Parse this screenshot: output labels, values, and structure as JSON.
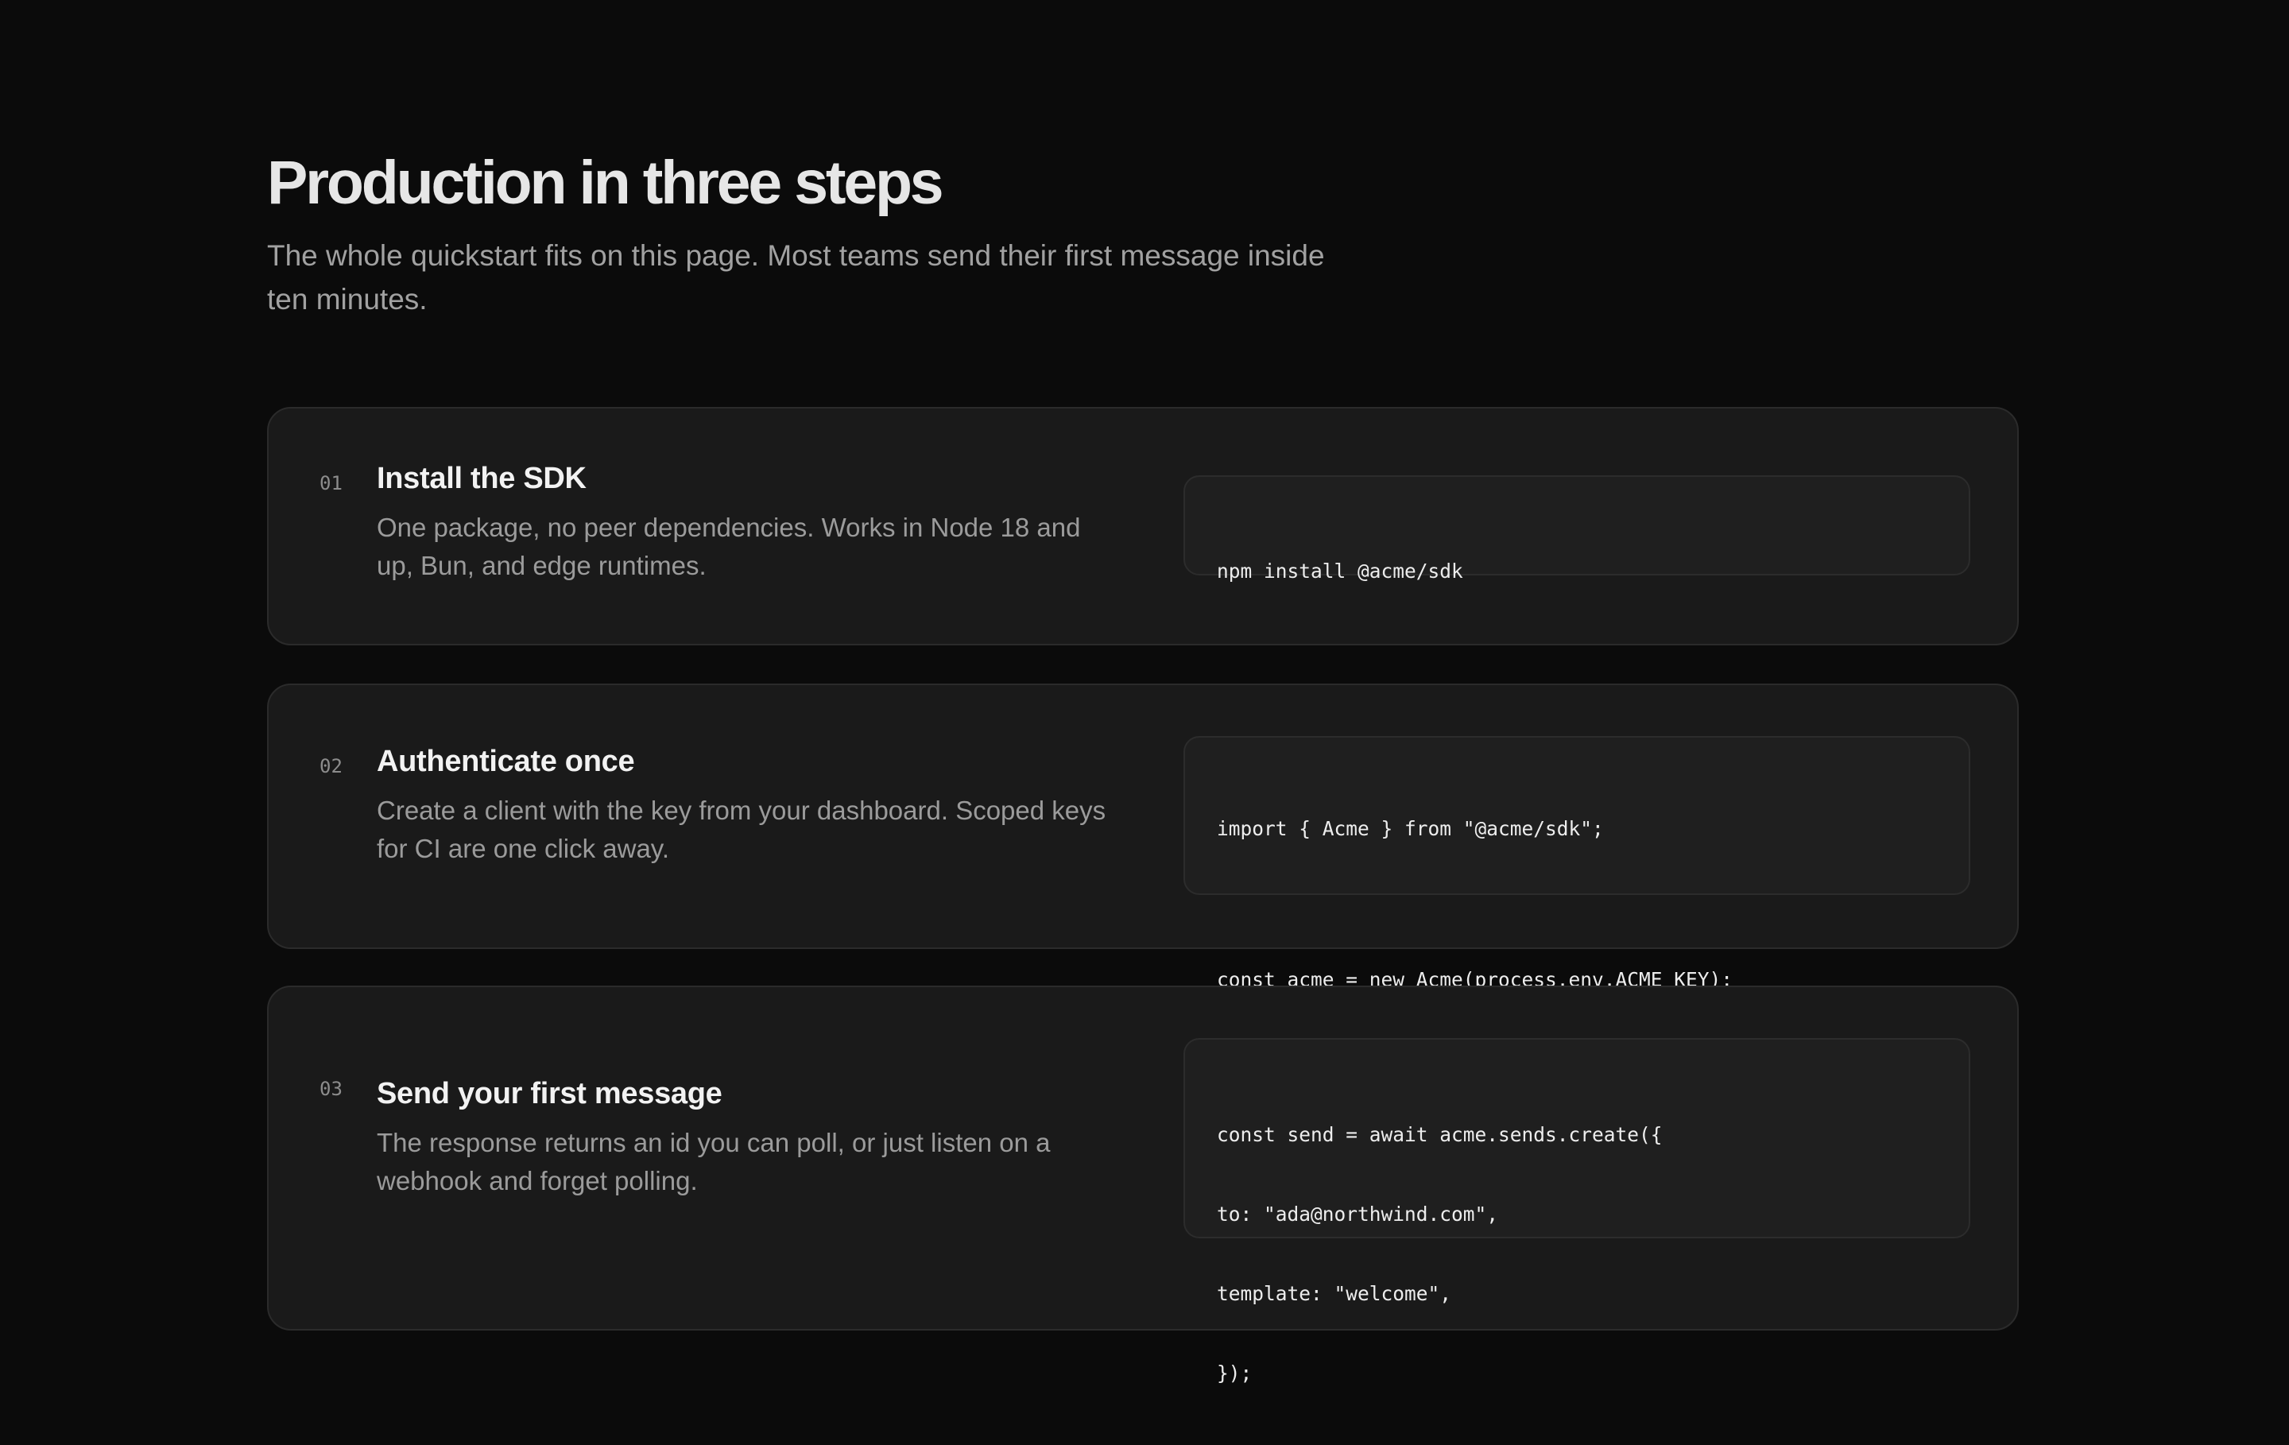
{
  "header": {
    "title": "Production in three steps",
    "subtitle": "The whole quickstart fits on this page. Most teams send their first message inside ten minutes."
  },
  "steps": [
    {
      "number": "01",
      "title": "Install the SDK",
      "description": "One package, no peer dependencies. Works in Node 18 and up, Bun, and edge runtimes.",
      "code": [
        "npm install @acme/sdk"
      ]
    },
    {
      "number": "02",
      "title": "Authenticate once",
      "description": "Create a client with the key from your dashboard. Scoped keys for CI are one click away.",
      "code": [
        "import { Acme } from \"@acme/sdk\";",
        "",
        "const acme = new Acme(process.env.ACME_KEY);"
      ]
    },
    {
      "number": "03",
      "title": "Send your first message",
      "description": "The response returns an id you can poll, or just listen on a webhook and forget polling.",
      "code": [
        "const send = await acme.sends.create({",
        "to: \"ada@northwind.com\",",
        "template: \"welcome\",",
        "});"
      ]
    }
  ],
  "colors": {
    "background": "#0b0b0b",
    "card": "#1a1a1a",
    "code_block": "#1f1f1f",
    "muted_text": "#9b9b9b"
  }
}
